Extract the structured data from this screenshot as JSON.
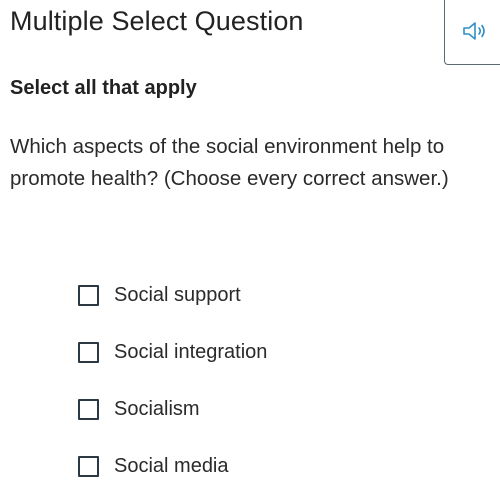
{
  "header": {
    "title": "Multiple Select Question",
    "audio_icon": "speaker-icon"
  },
  "question": {
    "instruction": "Select all that apply",
    "prompt": "Which aspects of the social environment help to promote health? (Choose every correct answer.)"
  },
  "options": [
    {
      "label": "Social support",
      "checked": false
    },
    {
      "label": "Social integration",
      "checked": false
    },
    {
      "label": "Socialism",
      "checked": false
    },
    {
      "label": "Social media",
      "checked": false
    }
  ],
  "colors": {
    "text": "#222222",
    "checkbox_border": "#2a3944",
    "audio_border": "#5b6a72",
    "audio_icon": "#2f8fc8"
  }
}
